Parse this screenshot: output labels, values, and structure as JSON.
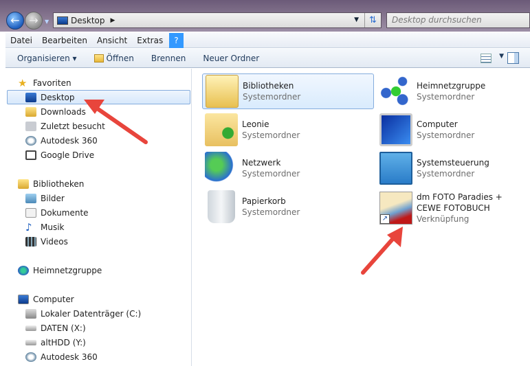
{
  "address": {
    "crumb": "Desktop"
  },
  "search": {
    "placeholder": "Desktop durchsuchen"
  },
  "menu": [
    "Datei",
    "Bearbeiten",
    "Ansicht",
    "Extras",
    "?"
  ],
  "toolbar": {
    "organize": "Organisieren ▾",
    "open": "Öffnen",
    "burn": "Brennen",
    "new_folder": "Neuer Ordner"
  },
  "nav": {
    "favorites": "Favoriten",
    "desktop": "Desktop",
    "downloads": "Downloads",
    "recent": "Zuletzt besucht",
    "autodesk1": "Autodesk 360",
    "gdrive": "Google Drive",
    "libraries": "Bibliotheken",
    "pictures": "Bilder",
    "documents": "Dokumente",
    "music": "Musik",
    "videos": "Videos",
    "homegroup": "Heimnetzgruppe",
    "computer": "Computer",
    "c": "Lokaler Datenträger (C:)",
    "x": "DATEN (X:)",
    "y": "altHDD (Y:)",
    "autodesk2": "Autodesk 360"
  },
  "items": [
    {
      "name": "Bibliotheken",
      "type": "Systemordner"
    },
    {
      "name": "Heimnetzgruppe",
      "type": "Systemordner"
    },
    {
      "name": "Leonie",
      "type": "Systemordner"
    },
    {
      "name": "Computer",
      "type": "Systemordner"
    },
    {
      "name": "Netzwerk",
      "type": "Systemordner"
    },
    {
      "name": "Systemsteuerung",
      "type": "Systemordner"
    },
    {
      "name": "Papierkorb",
      "type": "Systemordner"
    },
    {
      "name": "dm FOTO Paradies + CEWE FOTOBUCH",
      "type": "Verknüpfung"
    }
  ],
  "colors": {
    "arrow": "#e8453c",
    "selection": "#84acdd"
  }
}
